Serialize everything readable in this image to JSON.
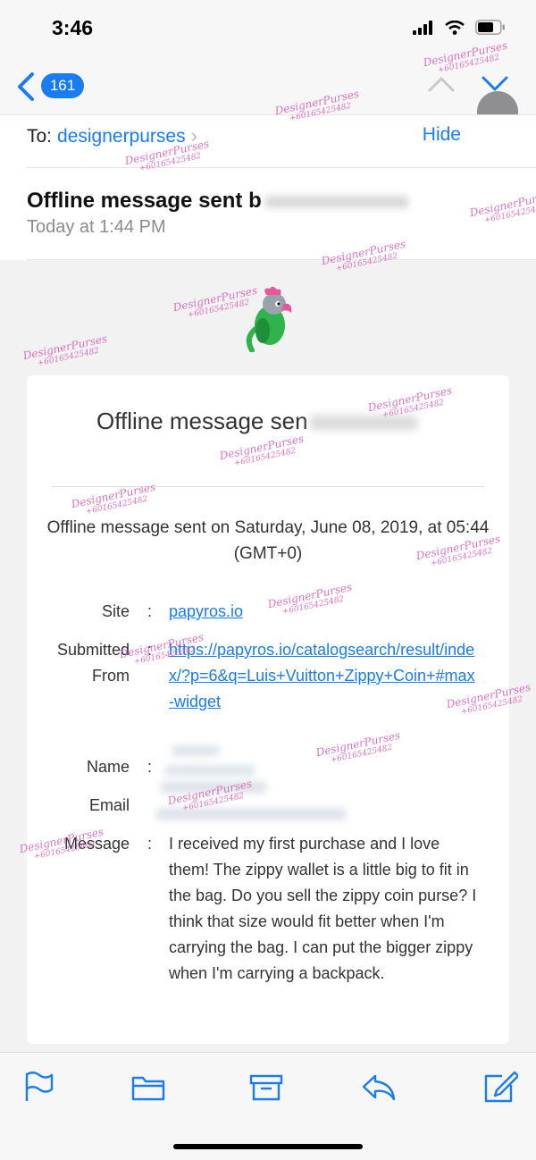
{
  "status_bar": {
    "time": "3:46",
    "icons": [
      "cellular-signal-icon",
      "wifi-icon",
      "battery-icon"
    ]
  },
  "nav": {
    "unread_count": "161"
  },
  "header": {
    "to_label": "To:",
    "to_value": "designerpurses",
    "hide_label": "Hide",
    "subject": "Offline message sent b",
    "date": "Today at 1:44 PM"
  },
  "email": {
    "title": "Offline message sen",
    "intro": "Offline message sent on Saturday, June 08, 2019, at 05:44 (GMT+0)",
    "rows": [
      {
        "label": "Site",
        "value": "papyros.io",
        "is_link": true
      },
      {
        "label": "Submitted From",
        "value": "https://papyros.io/catalogsearch/result/index/?p=6&q=Luis+Vuitton+Zippy+Coin+#max-widget",
        "is_link": true
      },
      {
        "label": "Name",
        "value": ""
      },
      {
        "label": "Email",
        "value": ""
      },
      {
        "label": "Message",
        "value": "I received my first purchase and I love them! The zippy wallet is a little big to fit in the bag. Do you sell the zippy coin purse? I think that size would fit better when I'm carrying the bag. I can put the bigger zippy when I'm carrying a backpack."
      }
    ]
  },
  "watermark": {
    "line1": "DesignerPurses",
    "line2": "+60165425482"
  },
  "colors": {
    "accent": "#1a7cf2",
    "watermark": "#d65ab7",
    "parrot_green": "#2fb34a",
    "parrot_pink": "#e8559a"
  },
  "toolbar": {
    "icons": [
      "flag-icon",
      "folder-icon",
      "archive-icon",
      "reply-icon",
      "compose-icon"
    ]
  }
}
